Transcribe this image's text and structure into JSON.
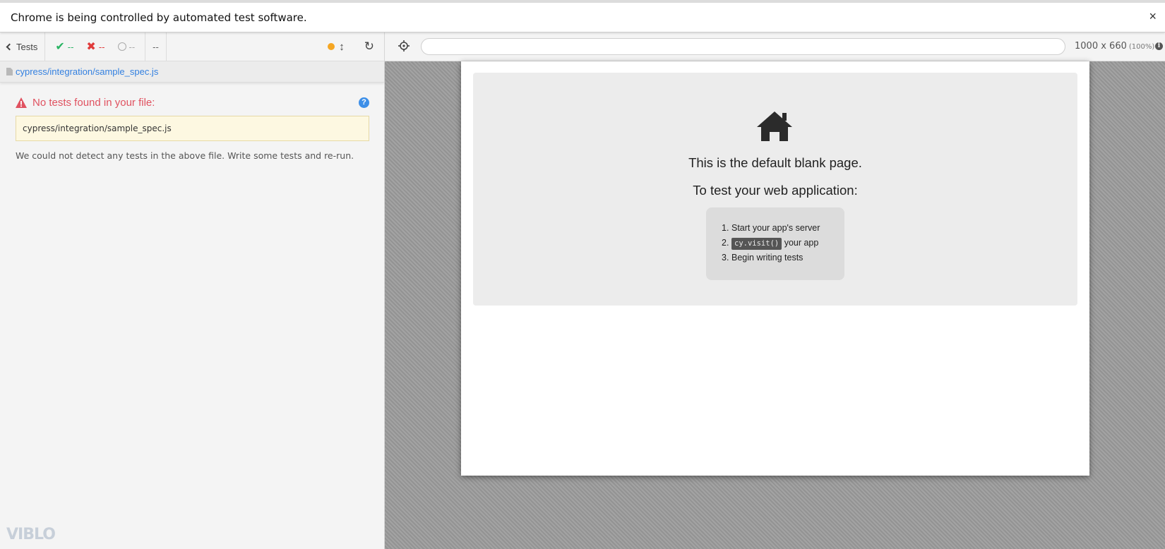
{
  "infobar": {
    "message": "Chrome is being controlled by automated test software.",
    "close_label": "×"
  },
  "reporter": {
    "header": {
      "tests_label": "Tests",
      "passed": "--",
      "failed": "--",
      "pending": "--",
      "duration": "--"
    },
    "spec_file": "cypress/integration/sample_spec.js",
    "error": {
      "title": "No tests found in your file:",
      "file": "cypress/integration/sample_spec.js",
      "description": "We could not detect any tests in the above file. Write some tests and re-run.",
      "help_label": "?"
    },
    "logo_text": "VIBLO"
  },
  "runner": {
    "url_value": "",
    "viewport": "1000 x 660",
    "zoom": "(100%)",
    "info_label": "i"
  },
  "aut": {
    "title": "This is the default blank page.",
    "subtitle": "To test your web application:",
    "steps": [
      {
        "num": "1.",
        "text": "Start your app's server"
      },
      {
        "num": "2.",
        "code": "cy.visit()",
        "text": " your app"
      },
      {
        "num": "3.",
        "text": "Begin writing tests"
      }
    ]
  },
  "colors": {
    "pass": "#29b463",
    "fail": "#e03b3b",
    "link": "#3380e0",
    "error": "#e05260",
    "running_dot": "#f5a623"
  }
}
